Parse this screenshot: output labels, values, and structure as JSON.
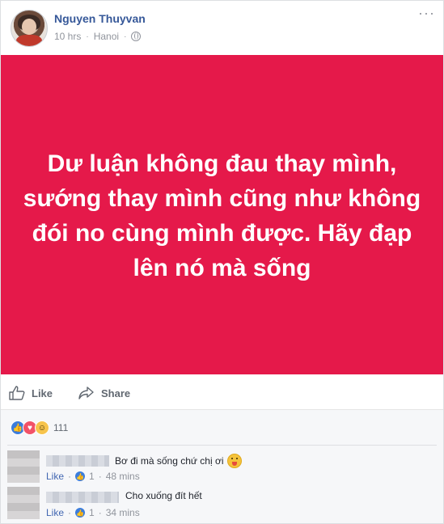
{
  "post": {
    "author": "Nguyen Thuyvan",
    "time": "10 hrs",
    "location": "Hanoi",
    "more_icon": "more-icon",
    "image_text": "Dư luận không đau thay mình, sướng thay mình cũng như không đói no cùng mình được. Hãy đạp lên nó mà sống",
    "image_bg": "#e5194a"
  },
  "actions": {
    "like_label": "Like",
    "share_label": "Share"
  },
  "reactions": {
    "count": "111",
    "types": [
      "like",
      "love",
      "haha"
    ]
  },
  "comments": [
    {
      "text": "Bơ đi mà sống chứ chị ơi",
      "like_label": "Like",
      "likes": "1",
      "time": "48 mins",
      "emoji": "tongue-emoji"
    },
    {
      "text": "Cho xuống đít hết",
      "like_label": "Like",
      "likes": "1",
      "time": "34 mins"
    }
  ],
  "colors": {
    "link": "#365899",
    "muted": "#90949c",
    "accent": "#4267b2"
  }
}
